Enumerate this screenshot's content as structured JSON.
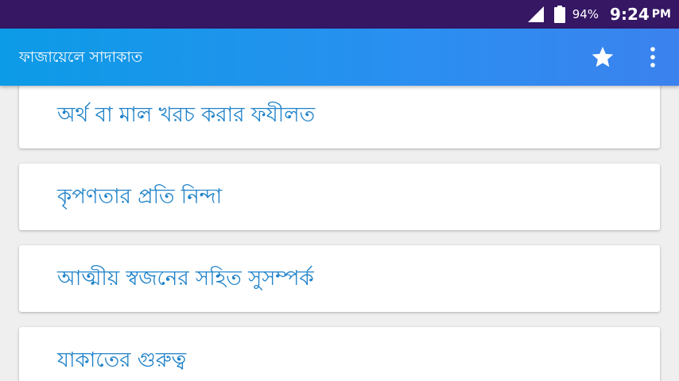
{
  "status_bar": {
    "battery_percent": "94%",
    "time": "9:24",
    "ampm": "PM",
    "icons": [
      "signal-icon",
      "battery-icon"
    ]
  },
  "app_bar": {
    "title": "ফাজায়েলে সাদাকাত",
    "icons": [
      "star-icon",
      "overflow-menu-icon"
    ],
    "color": "#1e94ec"
  },
  "list": {
    "items": [
      {
        "label": "অর্থ বা মাল খরচ করার ফযীলত"
      },
      {
        "label": "কৃপণতার প্রতি নিন্দা"
      },
      {
        "label": "আত্মীয় স্বজনের সহিত সুসম্পর্ক"
      },
      {
        "label": "যাকাতের গুরুত্ব"
      }
    ],
    "text_color": "#1f82c9"
  }
}
